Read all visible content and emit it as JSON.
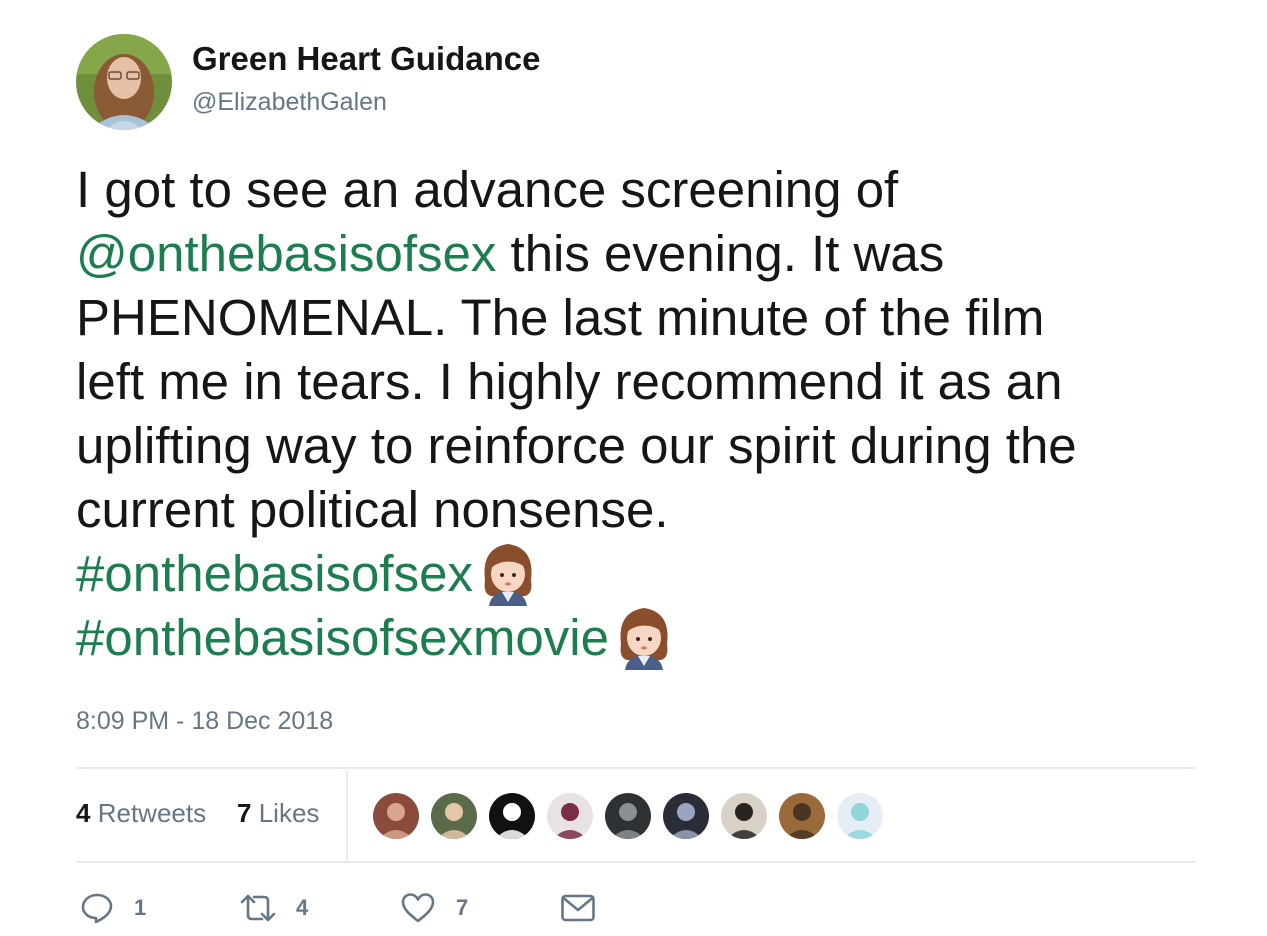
{
  "user": {
    "display_name": "Green Heart Guidance",
    "handle": "@ElizabethGalen"
  },
  "tweet": {
    "lines": [
      [
        {
          "text": "I got to see an advance screening of",
          "type": "text"
        }
      ],
      [
        {
          "text": "@onthebasisofsex",
          "type": "mention"
        },
        {
          "text": " this evening. It was",
          "type": "text"
        }
      ],
      [
        {
          "text": "PHENOMENAL. The last minute of the film",
          "type": "text"
        }
      ],
      [
        {
          "text": "left me in tears. I highly recommend it as an",
          "type": "text"
        }
      ],
      [
        {
          "text": "uplifting way to reinforce our spirit during the",
          "type": "text"
        }
      ],
      [
        {
          "text": "current political nonsense.",
          "type": "text"
        }
      ],
      [
        {
          "text": "#onthebasisofsex",
          "type": "hashtag"
        },
        {
          "emoji": "woman-judge-emoji"
        }
      ],
      [
        {
          "text": "#onthebasisofsexmovie",
          "type": "hashtag"
        },
        {
          "emoji": "woman-judge-emoji"
        }
      ]
    ],
    "timestamp": "8:09 PM - 18 Dec 2018"
  },
  "stats": {
    "retweets_count": "4",
    "retweets_label": "Retweets",
    "likes_count": "7",
    "likes_label": "Likes"
  },
  "likers": [
    {
      "name": "liker-avatar-1",
      "bg": "#8a4b3c",
      "fg": "#d9a58c"
    },
    {
      "name": "liker-avatar-2",
      "bg": "#5a6b4a",
      "fg": "#e3c7a8"
    },
    {
      "name": "liker-avatar-3",
      "bg": "#111111",
      "fg": "#ffffff"
    },
    {
      "name": "liker-avatar-4",
      "bg": "#e9e2e4",
      "fg": "#7a2e45"
    },
    {
      "name": "liker-avatar-5",
      "bg": "#2e3234",
      "fg": "#8a8f93"
    },
    {
      "name": "liker-avatar-6",
      "bg": "#2a2d38",
      "fg": "#9aa3c0"
    },
    {
      "name": "liker-avatar-7",
      "bg": "#d8d2c6",
      "fg": "#2a2420"
    },
    {
      "name": "liker-avatar-8",
      "bg": "#9a6a3a",
      "fg": "#4a3424"
    },
    {
      "name": "liker-avatar-9",
      "bg": "#e6eef5",
      "fg": "#8fd4d8"
    }
  ],
  "actions": {
    "reply_count": "1",
    "retweet_count": "4",
    "like_count": "7"
  },
  "colors": {
    "link": "#1c7d4f",
    "secondary_text": "#657786",
    "divider": "#e6ecf0"
  }
}
